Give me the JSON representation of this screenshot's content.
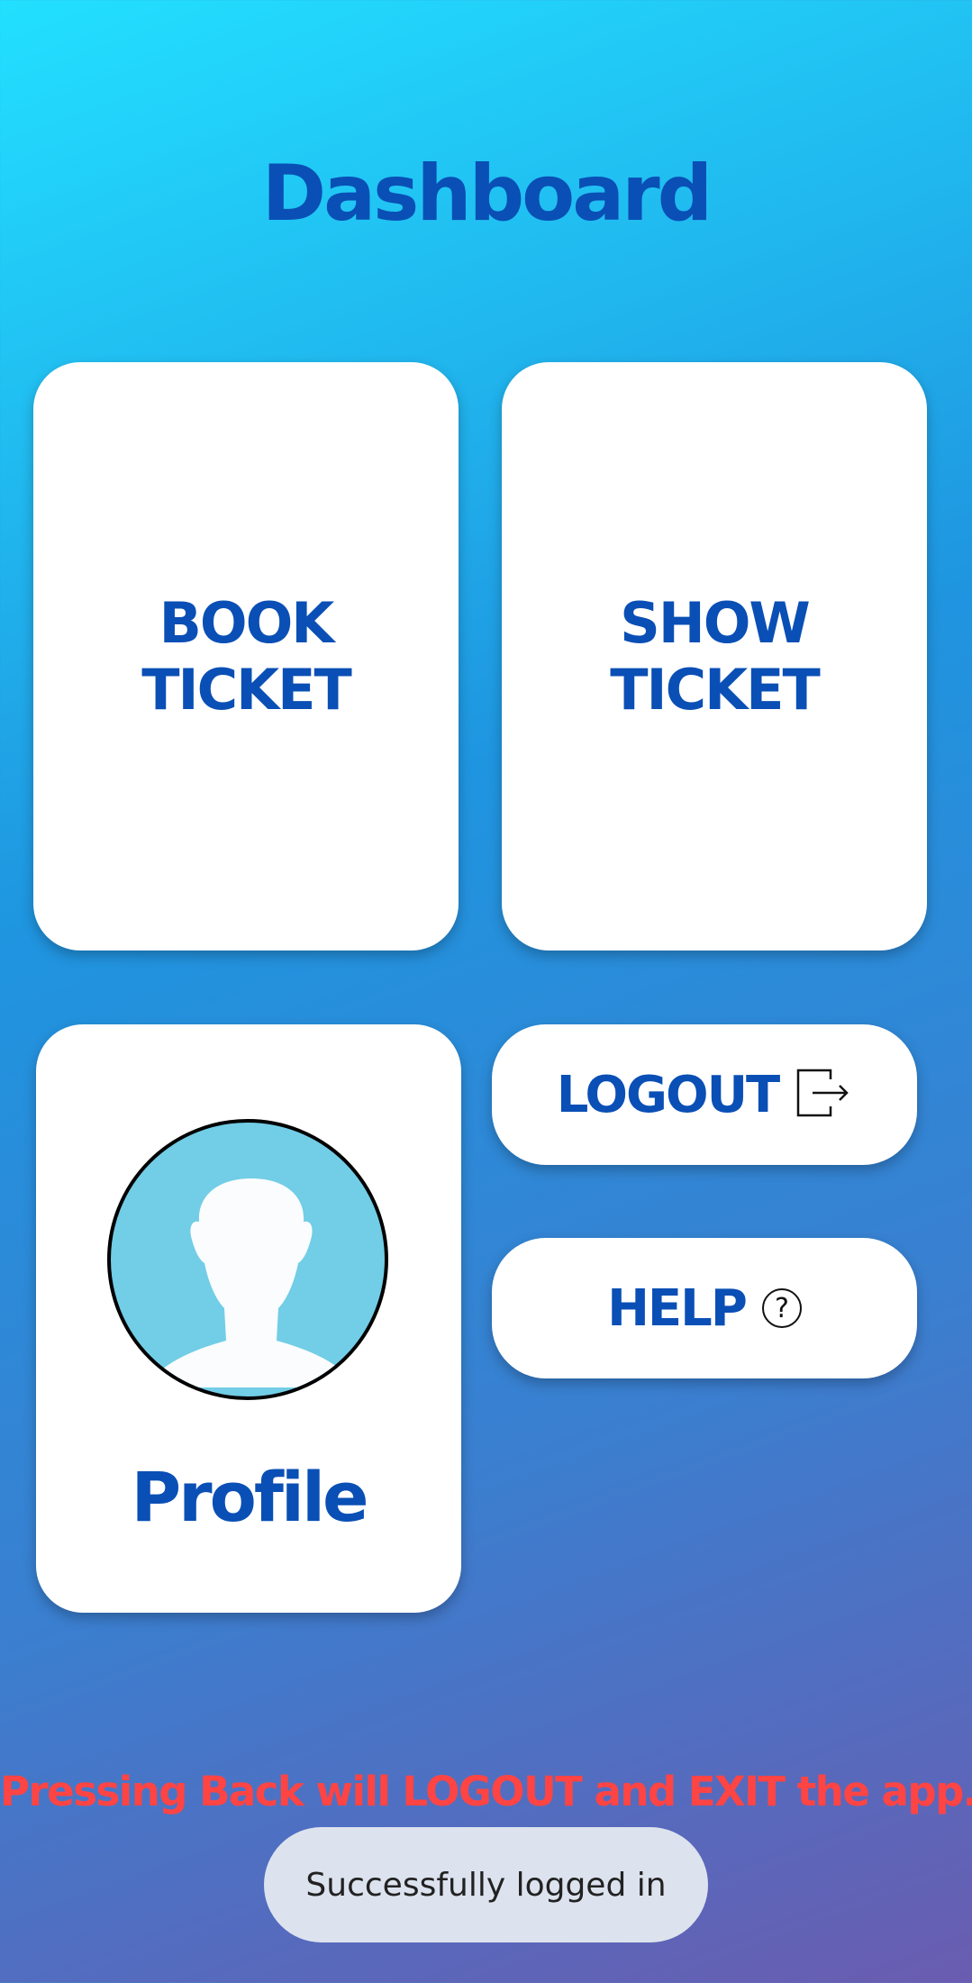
{
  "header": {
    "title": "Dashboard"
  },
  "cards": {
    "book_ticket": "BOOK\nTICKET",
    "show_ticket": "SHOW\nTICKET",
    "profile": "Profile",
    "logout": "LOGOUT",
    "help": "HELP",
    "help_icon_glyph": "?"
  },
  "icons": {
    "avatar": "user-silhouette-icon",
    "logout": "logout-icon",
    "help": "question-circle-icon"
  },
  "footer": {
    "warning": "Pressing Back will LOGOUT and EXIT the app.",
    "toast": "Successfully logged in"
  },
  "colors": {
    "accent": "#0a4fb5",
    "warning": "#ff4444",
    "avatar_bg": "#72cde6",
    "toast_bg": "#dde3ee"
  }
}
